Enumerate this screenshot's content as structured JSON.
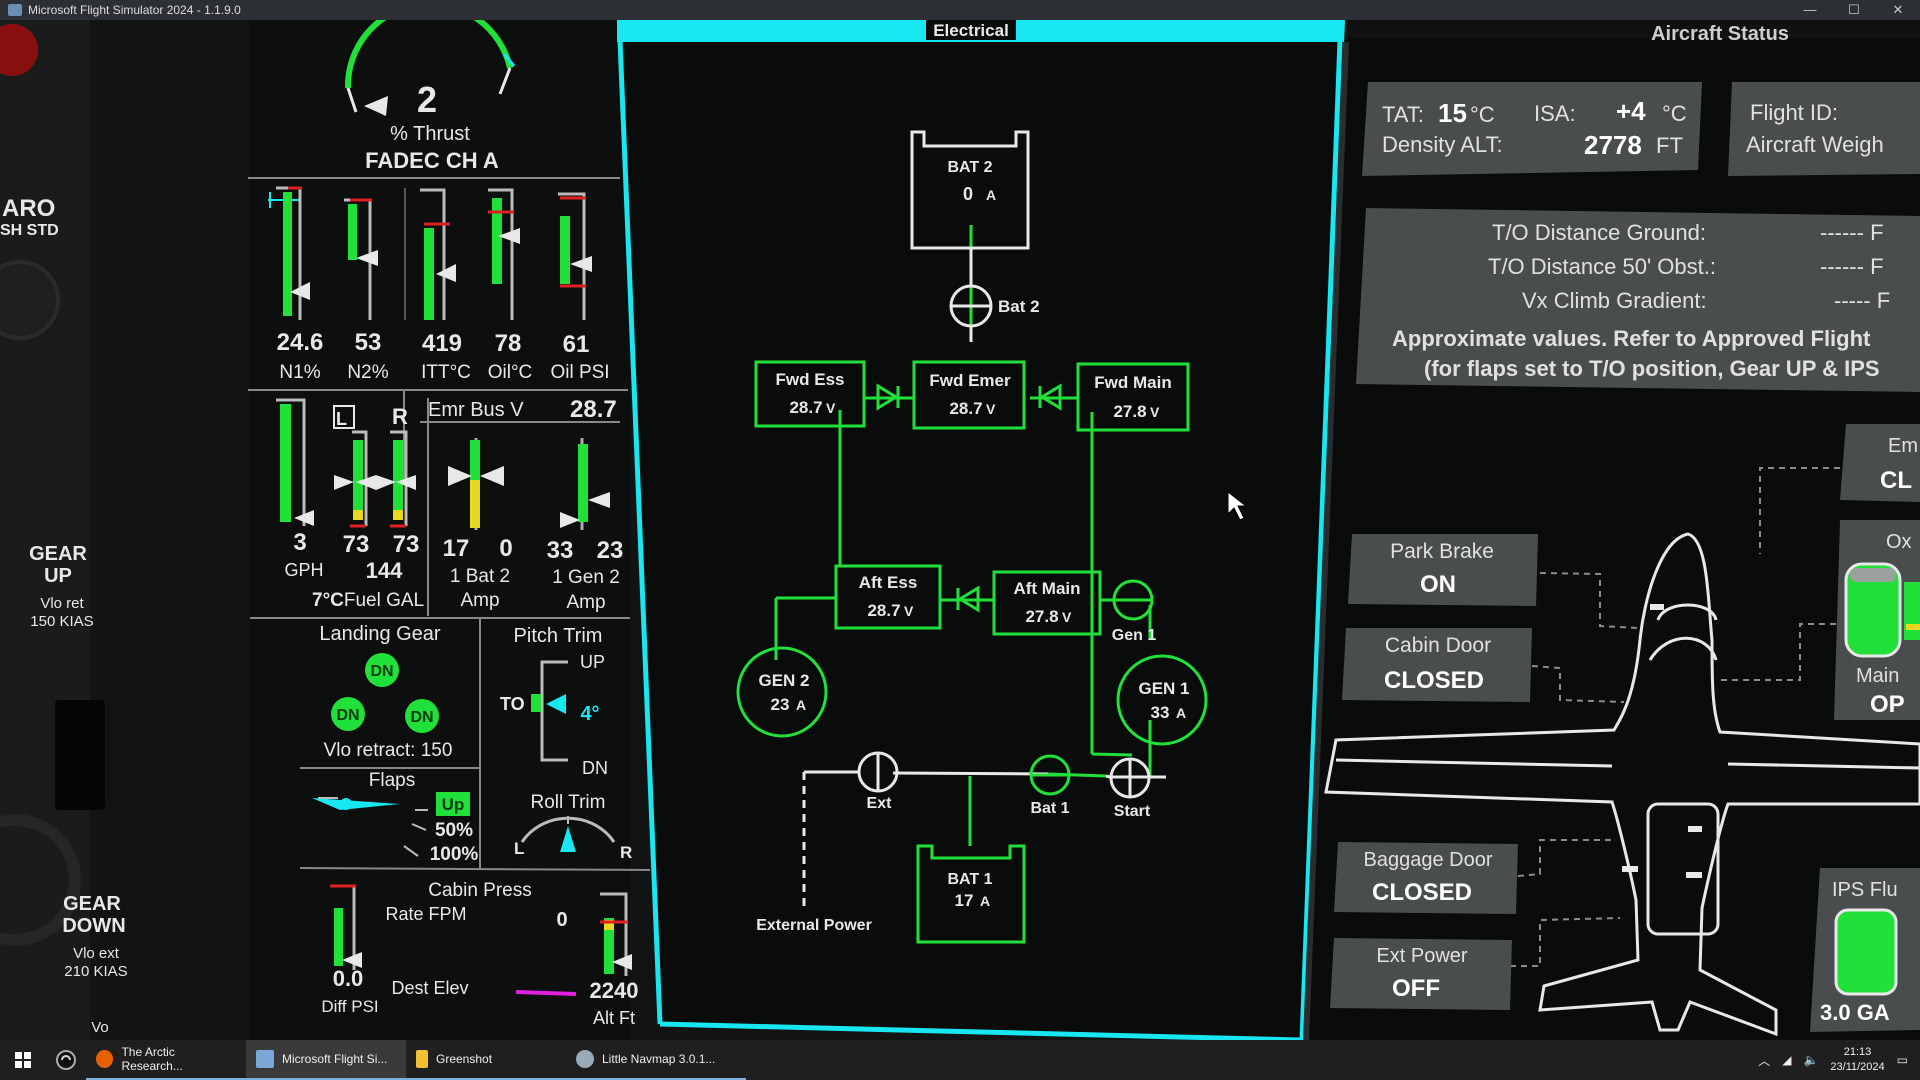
{
  "window": {
    "title": "Microsoft Flight Simulator 2024 - 1.1.9.0",
    "minimize": "—",
    "maximize": "☐",
    "close": "✕"
  },
  "left_panel": {
    "baro": "ARO",
    "baro_sub": "SH STD",
    "gear_up": "GEAR",
    "gear_up2": "UP",
    "gear_up_vlo": "Vlo ret",
    "gear_up_kias": "150  KIAS",
    "gear_down": "GEAR",
    "gear_down2": "DOWN",
    "gear_down_vlo": "Vlo ext",
    "gear_down_kias": "210  KIAS",
    "bottom": "Vo"
  },
  "engine": {
    "thrust_value": "2",
    "thrust_label": "% Thrust",
    "fadec": "FADEC CH A",
    "n1": "24.6",
    "n1_label": "N1%",
    "n2": "53",
    "n2_label": "N2%",
    "itt": "419",
    "itt_label": "ITT°C",
    "oil_c": "78",
    "oil_c_label": "Oil°C",
    "oil_psi": "61",
    "oil_psi_label": "Oil PSI",
    "fuel_flow": "3",
    "fuel_flow_label": "GPH",
    "fuel_l_tag": "L",
    "fuel_r_tag": "R",
    "fuel_l": "73",
    "fuel_r": "73",
    "fuel_total": "144",
    "oat": "7°C",
    "fuel_gal_label": "Fuel GAL",
    "emr_bus_label": "Emr Bus V",
    "emr_bus_value": "28.7",
    "bat1_amp": "17",
    "bat2_amp": "0",
    "bat_label": "1 Bat 2",
    "amp_label": "Amp",
    "gen1_amp": "33",
    "gen2_amp": "23",
    "gen_label": "1 Gen 2",
    "gen_amp_label": "Amp",
    "landing_gear_label": "Landing Gear",
    "gear_dn": "DN",
    "vlo_retract": "Vlo retract: 150",
    "pitch_trim_label": "Pitch Trim",
    "pitch_up": "UP",
    "pitch_to": "TO",
    "pitch_dn": "DN",
    "pitch_value": "4°",
    "flaps_label": "Flaps",
    "flaps_up": "Up",
    "flaps_50": "50%",
    "flaps_100": "100%",
    "roll_trim_label": "Roll Trim",
    "roll_l": "L",
    "roll_r": "R",
    "cabin_press_label": "Cabin Press",
    "rate_fpm_label": "Rate FPM",
    "rate_fpm": "0",
    "diff_psi": "0.0",
    "diff_psi_label": "Diff PSI",
    "dest_elev_label": "Dest Elev",
    "alt_ft": "2240",
    "alt_ft_label": "Alt Ft"
  },
  "electrical": {
    "title": "Electrical",
    "bat2_label": "BAT 2",
    "bat2_amp": "0",
    "bat2_switch": "Bat 2",
    "fwd_ess": "Fwd Ess",
    "fwd_ess_v": "28.7",
    "fwd_emer": "Fwd Emer",
    "fwd_emer_v": "28.7",
    "fwd_main": "Fwd Main",
    "fwd_main_v": "27.8",
    "aft_ess": "Aft Ess",
    "aft_ess_v": "28.7",
    "aft_main": "Aft Main",
    "aft_main_v": "27.8",
    "gen1_switch": "Gen 1",
    "gen1": "GEN 1",
    "gen1_a": "33",
    "gen2": "GEN 2",
    "gen2_a": "23",
    "ext": "Ext",
    "bat1_switch": "Bat 1",
    "start": "Start",
    "external_power": "External Power",
    "bat1_label": "BAT 1",
    "bat1_amp": "17",
    "unit_v": "V",
    "unit_a": "A"
  },
  "aircraft_status": {
    "title": "Aircraft Status",
    "tat_label": "TAT:",
    "tat": "15",
    "tat_unit": "°C",
    "isa_label": "ISA:",
    "isa": "+4",
    "isa_unit": "°C",
    "density_label": "Density ALT:",
    "density": "2778",
    "density_unit": "FT",
    "flight_id_label": "Flight ID:",
    "aircraft_weight_label": "Aircraft Weigh",
    "to_ground_label": "T/O Distance Ground:",
    "to_ground": "------ F",
    "to_50_label": "T/O Distance 50' Obst.:",
    "to_50": "------ F",
    "vx_label": "Vx Climb Gradient:",
    "vx": "----- F",
    "approx1": "Approximate values. Refer to Approved Flight",
    "approx2": "(for flaps set to T/O position, Gear UP & IPS",
    "park_brake_label": "Park Brake",
    "park_brake": "ON",
    "cabin_door_label": "Cabin Door",
    "cabin_door": "CLOSED",
    "baggage_door_label": "Baggage Door",
    "baggage_door": "CLOSED",
    "ext_power_label": "Ext Power",
    "ext_power": "OFF",
    "em_label": "Em",
    "em_value": "CL",
    "ox_label": "Ox",
    "main_label": "Main",
    "main_value": "OP",
    "ips_label": "IPS Flu",
    "ips_value": "3.0 GA"
  },
  "taskbar": {
    "items": [
      {
        "label": "The Arctic Research..."
      },
      {
        "label": "Microsoft Flight Si..."
      },
      {
        "label": "Greenshot"
      },
      {
        "label": "Little Navmap 3.0.1..."
      }
    ],
    "time": "21:13",
    "date": "23/11/2024"
  },
  "colors": {
    "green": "#22e03a",
    "cyan": "#18e6f0",
    "magenta": "#e020e0",
    "yellow": "#e8d820",
    "red": "#e02020",
    "panel_grey": "#4a4d4e"
  }
}
